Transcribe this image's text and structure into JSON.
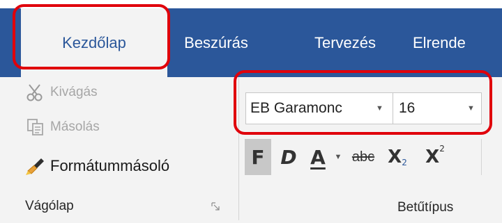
{
  "tabs": [
    {
      "label": "Kezdőlap",
      "active": true
    },
    {
      "label": "Beszúrás",
      "active": false
    },
    {
      "label": "Tervezés",
      "active": false
    },
    {
      "label": "Elrende",
      "active": false
    }
  ],
  "clipboard": {
    "cut_label": "Kivágás",
    "copy_label": "Másolás",
    "format_painter_label": "Formátummásoló",
    "group_label": "Vágólap"
  },
  "font": {
    "font_name": "EB Garamonc",
    "font_size": "16",
    "bold_label": "F",
    "italic_label": "D",
    "underline_label": "A",
    "strike_label": "abc",
    "subscript_label": "X",
    "subscript_suffix": "2",
    "superscript_label": "X",
    "superscript_suffix": "2",
    "group_label": "Betűtípus"
  },
  "colors": {
    "ribbon_blue": "#2b579a",
    "highlight_red": "#e0000b",
    "ribbon_bg": "#f3f3f3"
  }
}
